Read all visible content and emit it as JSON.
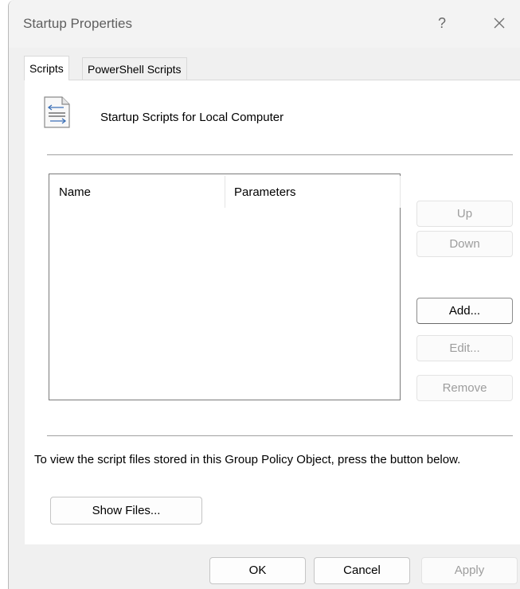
{
  "window": {
    "title": "Startup Properties",
    "help_label": "?"
  },
  "tabs": [
    {
      "label": "Scripts",
      "active": true
    },
    {
      "label": "PowerShell Scripts",
      "active": false
    }
  ],
  "panel": {
    "heading": "Startup Scripts for Local Computer",
    "icon": "script-file-icon",
    "list": {
      "columns": [
        "Name",
        "Parameters"
      ],
      "rows": []
    },
    "side_buttons": {
      "up": "Up",
      "down": "Down",
      "add": "Add...",
      "edit": "Edit...",
      "remove": "Remove"
    },
    "info_text": "To view the script files stored in this Group Policy Object, press the button below.",
    "show_files_label": "Show Files..."
  },
  "footer": {
    "ok": "OK",
    "cancel": "Cancel",
    "apply": "Apply"
  },
  "colors": {
    "dialog_bg": "#f0f0f0",
    "panel_bg": "#ffffff",
    "disabled_text": "#9d9d9d"
  }
}
